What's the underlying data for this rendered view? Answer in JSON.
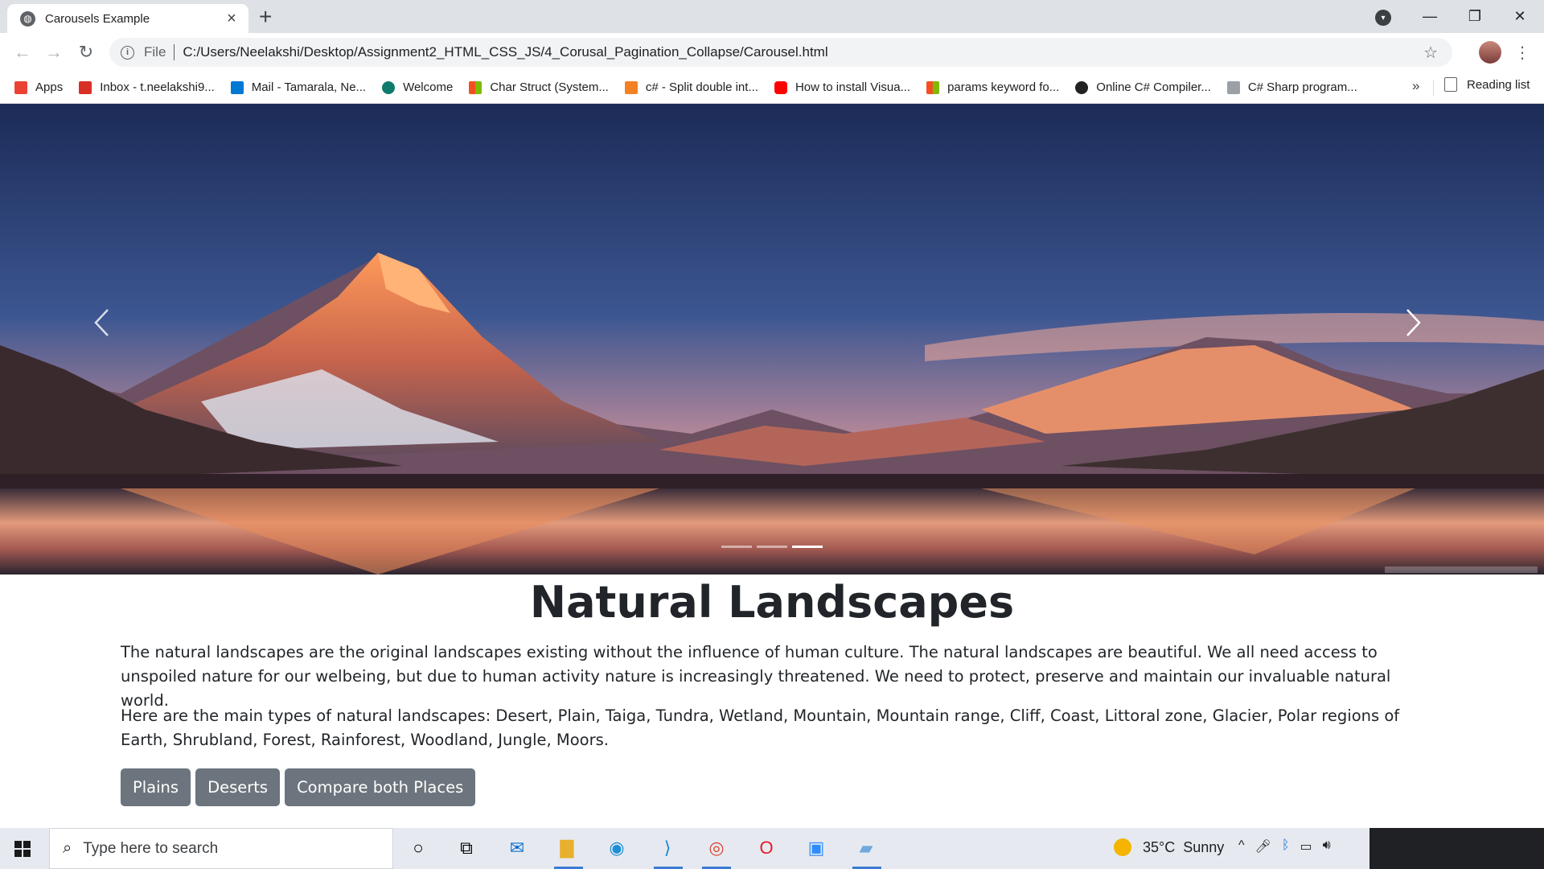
{
  "browser": {
    "tab_title": "Carousels Example",
    "url_scheme_label": "File",
    "url": "C:/Users/Neelakshi/Desktop/Assignment2_HTML_CSS_JS/4_Corusal_Pagination_Collapse/Carousel.html",
    "bookmarks": [
      {
        "label": "Apps",
        "icon": "apps-grid-icon",
        "color": "#ea4335"
      },
      {
        "label": "Inbox - t.neelakshi9...",
        "icon": "gmail-icon",
        "color": "#d93025"
      },
      {
        "label": "Mail - Tamarala, Ne...",
        "icon": "outlook-icon",
        "color": "#0078d4"
      },
      {
        "label": "Welcome",
        "icon": "welcome-icon",
        "color": "#0f7b6c"
      },
      {
        "label": "Char Struct (System...",
        "icon": "microsoft-icon",
        "color": "#f25022"
      },
      {
        "label": "c# - Split double int...",
        "icon": "stackoverflow-icon",
        "color": "#f48024"
      },
      {
        "label": "How to install Visua...",
        "icon": "youtube-icon",
        "color": "#ff0000"
      },
      {
        "label": "params keyword fo...",
        "icon": "microsoft-icon",
        "color": "#f25022"
      },
      {
        "label": "Online C# Compiler...",
        "icon": "compiler-icon",
        "color": "#222222"
      },
      {
        "label": "C# Sharp program...",
        "icon": "w3r-icon",
        "color": "#9aa0a6"
      }
    ],
    "more_label": "»",
    "reading_list_label": "Reading list"
  },
  "carousel": {
    "slide_count": 3,
    "active_index": 2,
    "prev_icon": "chevron-left-icon",
    "next_icon": "chevron-right-icon"
  },
  "content": {
    "heading": "Natural Landscapes",
    "paragraph1": "The natural landscapes are the original landscapes existing without the influence of human culture. The natural landscapes are beautiful. We all need access to unspoiled nature for our welbeing, but due to human activity nature is increasingly threatened. We need to protect, preserve and maintain our invaluable natural world.",
    "paragraph2": "Here are the main types of natural landscapes: Desert, Plain, Taiga, Tundra, Wetland, Mountain, Mountain range, Cliff, Coast, Littoral zone, Glacier, Polar regions of Earth, Shrubland, Forest, Rainforest, Woodland, Jungle, Moors.",
    "buttons": [
      "Plains",
      "Deserts",
      "Compare both Places"
    ],
    "button_color": "#6c757d"
  },
  "taskbar": {
    "search_placeholder": "Type here to search",
    "weather_temp": "35°C",
    "weather_desc": "Sunny"
  }
}
